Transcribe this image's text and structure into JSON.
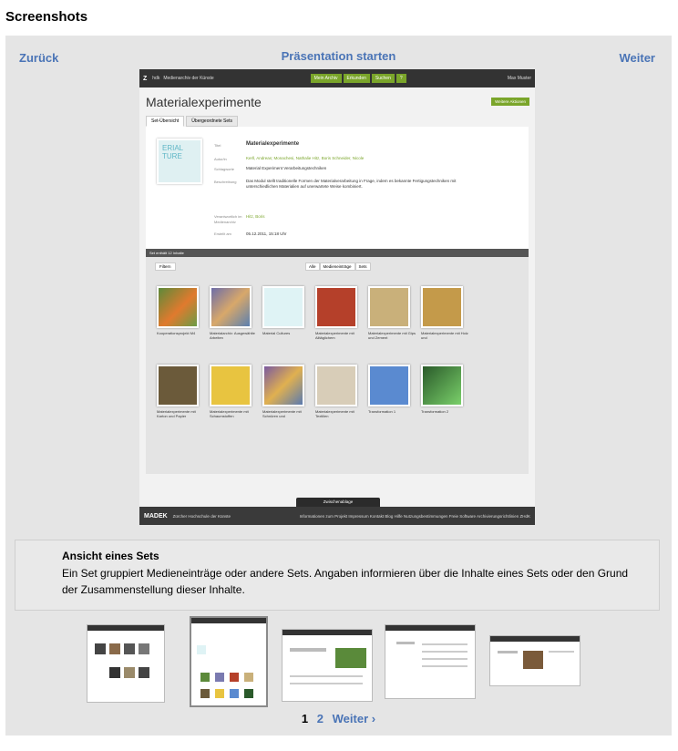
{
  "heading": "Screenshots",
  "nav": {
    "prev": "Zurück",
    "start": "Präsentation starten",
    "next": "Weiter"
  },
  "screenshot": {
    "logo": "Z",
    "org": "hdk",
    "subtitle": "Medienarchiv der Künste",
    "menu": [
      "Mein Archiv",
      "Erkunden",
      "Suchen",
      "?"
    ],
    "user": "Max Muster",
    "title": "Materialexperimente",
    "action": "Weitere Aktionen",
    "tabs": [
      "Set-Übersicht",
      "Übergeordnete Sets"
    ],
    "cover_text": "ERIAL TURE",
    "meta": {
      "title_label": "Titel",
      "title_value": "Materialexperimente",
      "author_label": "Autor/in",
      "author_value": "Kerll, Andreas; Monachesi, Nathalie Hitz, Boris Schneider, Nicole",
      "tags_label": "Schlagworte",
      "tags_value": "Material  Experiment  Verarbeitungstechniken",
      "desc_label": "Beschreibung",
      "desc_value": "Das Modul stellt traditionelle Formen der Materialverarbeitung in Frage, indem es bekannte Fertigungstechniken mit unterschiedlichen Materialien auf unerwartete Weise kombiniert.",
      "resp_label": "Verantwortlich im Medienarchiv",
      "resp_value": "Hitz, Boris",
      "created_label": "Erstellt am",
      "created_value": "05.12.2011, 15:18 Uhr"
    },
    "count_bar": "Set enthält 12 Inhalte",
    "filter": "Filtern",
    "segments": [
      "Alle",
      "Medieneinträge",
      "Sets"
    ],
    "tiles": [
      "Kooperationsprojekt M4",
      "Materialarchiv: Ausgewählte Arbeiten",
      "Material Cultures",
      "Materialexperimente mit Alltäglichem",
      "Materialexperimente mit Gips und Zement",
      "Materialexperimente mit Holz und",
      "Materialexperimente mit Karton und Papier",
      "Materialexperimente mit Schaumstoffen",
      "Materialexperimente mit Schnüren und",
      "Materialexperimente mit Textilien",
      "Transformation 1",
      "Transformation 2"
    ],
    "clipboard": "Zwischenablage",
    "footer_logo": "MADEK",
    "footer_org": "Zürcher Hochschule der Künste",
    "footer_links": "Informationen zum Projekt  Impressum  Kontakt  Blog  Hilfe  Nutzungsbestimmungen  Freie Software  Archivierungsrichtlinien ZHdK"
  },
  "caption": {
    "title": "Ansicht eines Sets",
    "text": "Ein Set gruppiert Medieneinträge oder andere Sets. Angaben informieren über die Inhalte eines Sets oder den Grund der Zusammenstellung dieser Inhalte."
  },
  "pager": {
    "current": "1",
    "page2": "2",
    "next": "Weiter ›"
  },
  "colors": {
    "link": "#4a74b6",
    "accent": "#7aa52a"
  }
}
